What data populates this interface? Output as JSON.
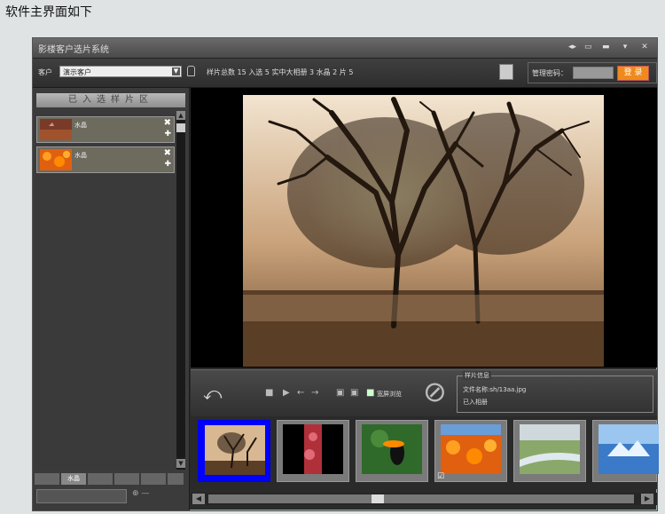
{
  "caption": "软件主界面如下",
  "window": {
    "title": "影楼客户选片系统",
    "controls": [
      "◂▸",
      "▭",
      "▬",
      "▾",
      "✕"
    ]
  },
  "toolbar": {
    "customer_label": "客户",
    "customer_value": "演示客户",
    "stats": "样片总数 15  入选 5  实中大相册 3  水晶 2  片 5",
    "password_label": "管理密码：",
    "login_button": "登 录"
  },
  "left_panel": {
    "header": "已入选样片区",
    "items": [
      {
        "label": "水晶"
      },
      {
        "label": "水晶"
      }
    ],
    "tabs": [
      "",
      "水晶",
      "",
      "",
      "",
      ""
    ],
    "bottom_button": "⊕ —"
  },
  "controls": {
    "fullscreen_label": "宽屏浏览",
    "info": {
      "title": "样片信息",
      "filename": "文件名称:sh/13aa.jpg",
      "status": "已入相册"
    }
  },
  "thumbnails": [
    {
      "name": "tree-sunset",
      "selected": true
    },
    {
      "name": "red-pattern",
      "selected": false
    },
    {
      "name": "toucan",
      "selected": false
    },
    {
      "name": "orange-flowers",
      "selected": false,
      "checked": true
    },
    {
      "name": "river-landscape",
      "selected": false
    },
    {
      "name": "iceberg",
      "selected": false
    }
  ],
  "colors": {
    "accent_orange": "#f08a1c",
    "selected_frame": "#0000ff"
  }
}
